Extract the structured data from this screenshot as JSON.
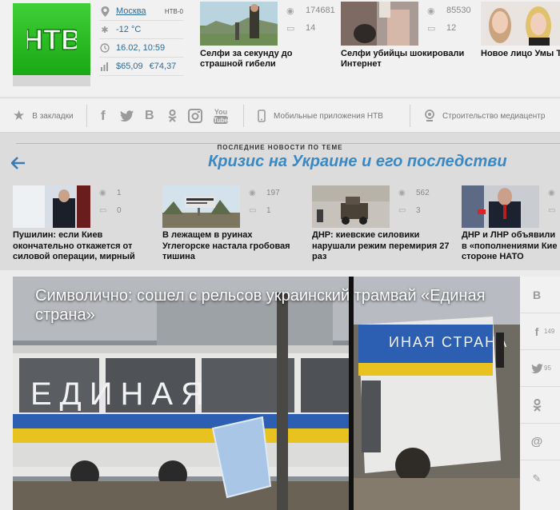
{
  "header": {
    "logo_text": "НТВ",
    "info": {
      "city": "Москва",
      "channel": "НТВ-0",
      "temperature": "-12 °C",
      "datetime": "16.02, 10:59",
      "usd": "$65,09",
      "eur": "€74,37"
    },
    "top_news": [
      {
        "views": "174681",
        "comments": "14",
        "title": "Селфи за секунду до страшной гибели"
      },
      {
        "views": "85530",
        "comments": "12",
        "title": "Селфи убийцы шокировали Интернет"
      },
      {
        "title": "Новое лицо Умы Т"
      }
    ]
  },
  "social": {
    "bookmarks_label": "В закладки",
    "networks": [
      "facebook-icon",
      "twitter-icon",
      "vk-icon",
      "odnoklassniki-icon",
      "instagram-icon",
      "youtube-icon"
    ],
    "mobile_label": "Мобильные приложения НТВ",
    "media_center_label": "Строительство медиацентр"
  },
  "crisis": {
    "section_label": "ПОСЛЕДНИЕ НОВОСТИ ПО ТЕМЕ",
    "title": "Кризис на Украине и его последстви",
    "items": [
      {
        "views": "1",
        "comments": "0",
        "title": "Пушилин: если Киев окончательно откажется от силовой операции, мирный"
      },
      {
        "views": "197",
        "comments": "1",
        "title": "В лежащем в руинах Углегорске настала гробовая тишина"
      },
      {
        "views": "562",
        "comments": "3",
        "title": "ДНР: киевские силовики нарушали режим перемирия 27 раз"
      },
      {
        "title": "ДНР и ЛНР объявили в «пополнениями Кие стороне НАТО"
      }
    ]
  },
  "feature": {
    "title": "Символично: сошел с рельсов украинский трамвай «Единая страна»",
    "tram_text_left": "ЕДИНАЯ",
    "tram_text_right": "ИНАЯ СТРАНА"
  },
  "share": {
    "counts": [
      "",
      "149",
      "95"
    ]
  }
}
